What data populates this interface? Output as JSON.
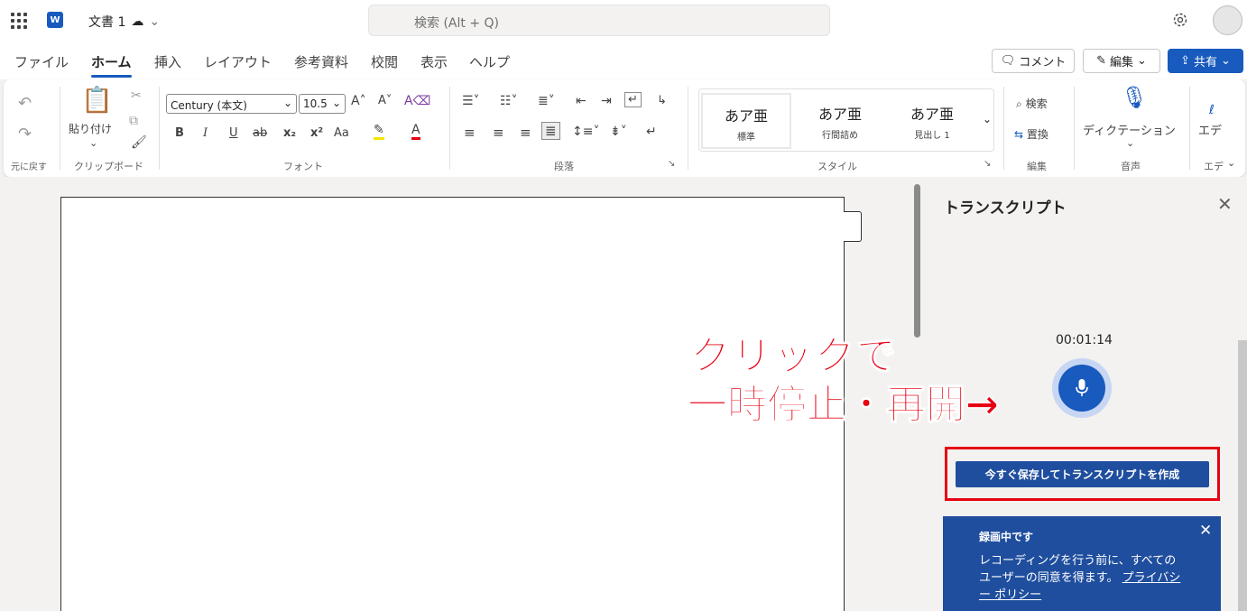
{
  "app": {
    "logo_letter": "W",
    "doc_title": "文書 1",
    "search_placeholder": "検索 (Alt + Q)"
  },
  "menu": {
    "tabs": [
      "ファイル",
      "ホーム",
      "挿入",
      "レイアウト",
      "参考資料",
      "校閲",
      "表示",
      "ヘルプ"
    ],
    "active_tab": "ホーム",
    "comment_label": "コメント",
    "edit_label": "編集",
    "share_label": "共有"
  },
  "ribbon": {
    "undo_group_label": "元に戻す",
    "paste_label": "貼り付け",
    "clipboard_group_label": "クリップボード",
    "font_name": "Century (本文)",
    "font_size": "10.5",
    "font_group_label": "フォント",
    "bold": "B",
    "italic": "I",
    "underline": "U",
    "strike": "ab",
    "subscript": "x₂",
    "superscript": "x²",
    "case": "Aa",
    "paragraph_group_label": "段落",
    "styles": [
      {
        "preview": "あア亜",
        "name": "標準"
      },
      {
        "preview": "あア亜",
        "name": "行間詰め"
      },
      {
        "preview": "あア亜",
        "name": "見出し 1"
      }
    ],
    "style_group_label": "スタイル",
    "find_label": "検索",
    "replace_label": "置換",
    "edit_group_label": "編集",
    "dictation_label": "ディクテーション",
    "voice_group_label": "音声",
    "editor_label": "エデ",
    "editor_group_label": "エデ"
  },
  "transcript": {
    "title": "トランスクリプト",
    "elapsed": "00:01:14",
    "save_button": "今すぐ保存してトランスクリプトを作成",
    "notice_title": "録画中です",
    "notice_body": "レコーディングを行う前に、すべてのユーザーの同意を得ます。",
    "notice_link": "プライバシー ポリシー"
  },
  "annotation": {
    "line1": "クリックで",
    "line2": "一時停止・再開→",
    "color": "#e60012"
  },
  "colors": {
    "accent": "#185abd",
    "panel_button": "#1f4e9e"
  }
}
